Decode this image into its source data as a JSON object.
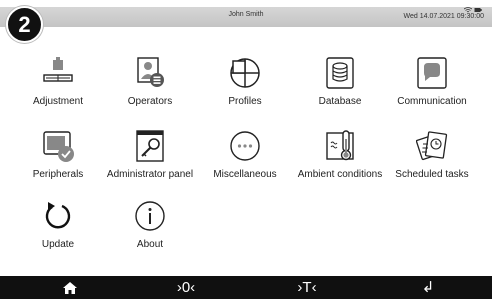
{
  "header": {
    "badge": "2",
    "user": "John Smith",
    "datetime": "Wed 14.07.2021  09:30:00",
    "wifi_icon": "wifi-icon",
    "battery_icon": "battery-icon"
  },
  "tiles": [
    {
      "label": "Adjustment",
      "icon": "adjustment-weight-icon"
    },
    {
      "label": "Operators",
      "icon": "operators-icon"
    },
    {
      "label": "Profiles",
      "icon": "profiles-icon"
    },
    {
      "label": "Database",
      "icon": "database-icon"
    },
    {
      "label": "Communication",
      "icon": "communication-icon"
    },
    {
      "label": "Peripherals",
      "icon": "peripherals-icon"
    },
    {
      "label": "Administrator panel",
      "icon": "administrator-key-icon"
    },
    {
      "label": "Miscellaneous",
      "icon": "miscellaneous-dots-icon"
    },
    {
      "label": "Ambient conditions",
      "icon": "ambient-thermometer-icon"
    },
    {
      "label": "Scheduled tasks",
      "icon": "scheduled-tasks-icon"
    },
    {
      "label": "Update",
      "icon": "update-icon"
    },
    {
      "label": "About",
      "icon": "info-icon"
    }
  ],
  "navbar": {
    "home_icon": "home-icon",
    "zero_label": "›0‹",
    "tare_label": "›T‹",
    "enter_label": "↲"
  }
}
